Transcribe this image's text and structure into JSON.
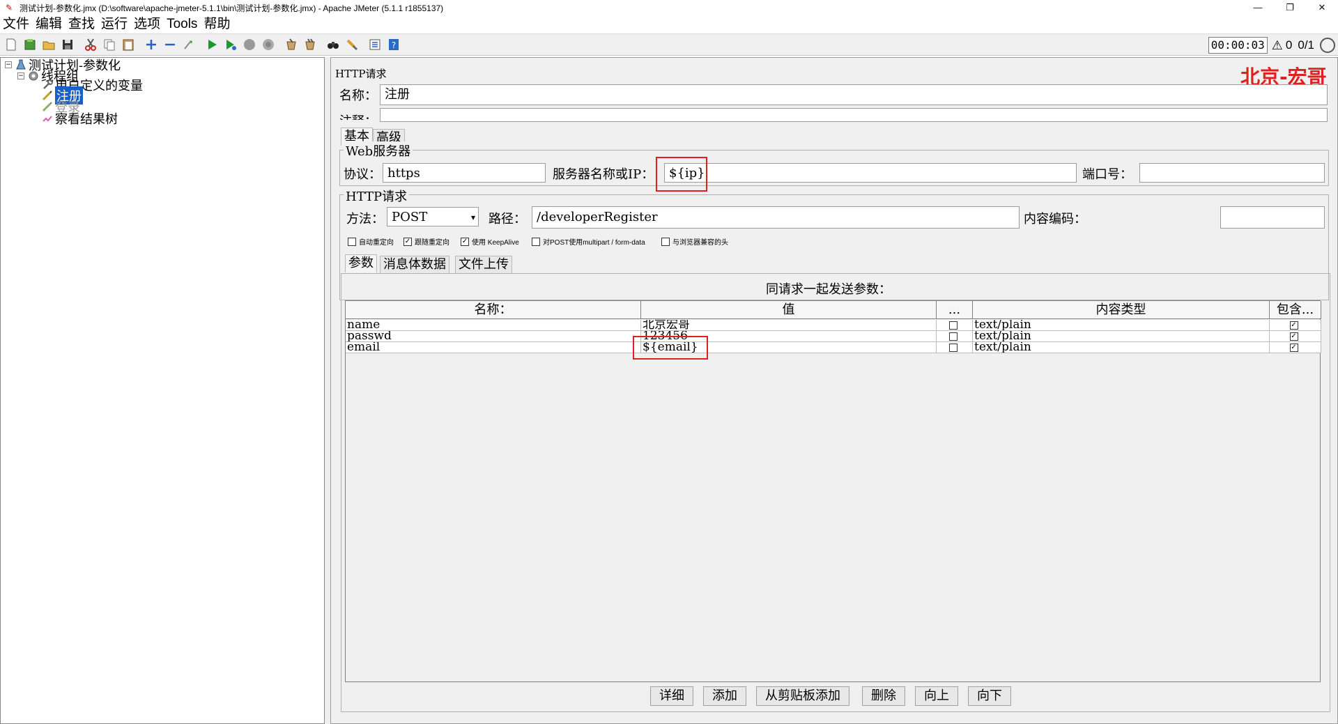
{
  "window": {
    "title": "测试计划-参数化.jmx (D:\\software\\apache-jmeter-5.1.1\\bin\\测试计划-参数化.jmx) - Apache JMeter (5.1.1 r1855137)",
    "minimize": "—",
    "restore": "❐",
    "close": "✕"
  },
  "menu": [
    "文件",
    "编辑",
    "查找",
    "运行",
    "选项",
    "Tools",
    "帮助"
  ],
  "status": {
    "timer": "00:00:03",
    "warnings": "0",
    "threads": "0/1"
  },
  "tree": {
    "expand_minus": "−",
    "items": [
      {
        "label": "测试计划-参数化",
        "icon": "flask-icon"
      },
      {
        "label": "线程组",
        "icon": "gear-icon"
      },
      {
        "label": "用户定义的变量",
        "icon": "wrench-icon"
      },
      {
        "label": "注册",
        "icon": "pencil-icon",
        "selected": true
      },
      {
        "label": "登录",
        "icon": "pencil-icon",
        "disabled": true
      },
      {
        "label": "察看结果树",
        "icon": "chart-icon"
      }
    ]
  },
  "panel": {
    "title": "HTTP请求",
    "watermark": "北京-宏哥",
    "name_label": "名称：",
    "name_value": "注册",
    "comment_label": "注释：",
    "tabs": [
      "基本",
      "高级"
    ],
    "web_server": {
      "legend": "Web服务器",
      "protocol_label": "协议：",
      "protocol_value": "https",
      "server_label": "服务器名称或IP：",
      "server_value": "${ip}",
      "port_label": "端口号：",
      "port_value": ""
    },
    "http_request": {
      "legend": "HTTP请求",
      "method_label": "方法：",
      "method_value": "POST",
      "path_label": "路径：",
      "path_value": "/developerRegister",
      "encoding_label": "内容编码：",
      "encoding_value": ""
    },
    "checkboxes": [
      {
        "label": "自动重定向",
        "checked": false
      },
      {
        "label": "跟随重定向",
        "checked": true
      },
      {
        "label": "使用 KeepAlive",
        "checked": true
      },
      {
        "label": "对POST使用multipart / form-data",
        "checked": false
      },
      {
        "label": "与浏览器兼容的头",
        "checked": false
      }
    ],
    "sub_tabs": [
      "参数",
      "消息体数据",
      "文件上传"
    ],
    "params_caption": "同请求一起发送参数：",
    "columns": [
      "名称：",
      "值",
      "...",
      "内容类型",
      "包含..."
    ],
    "rows": [
      {
        "name": "name",
        "value": "北京宏哥",
        "content_type": "text/plain",
        "include": true
      },
      {
        "name": "passwd",
        "value": "123456",
        "content_type": "text/plain",
        "include": true
      },
      {
        "name": "email",
        "value": "${email}",
        "content_type": "text/plain",
        "include": true
      }
    ],
    "buttons": [
      "详细",
      "添加",
      "从剪贴板添加",
      "删除",
      "向上",
      "向下"
    ]
  }
}
